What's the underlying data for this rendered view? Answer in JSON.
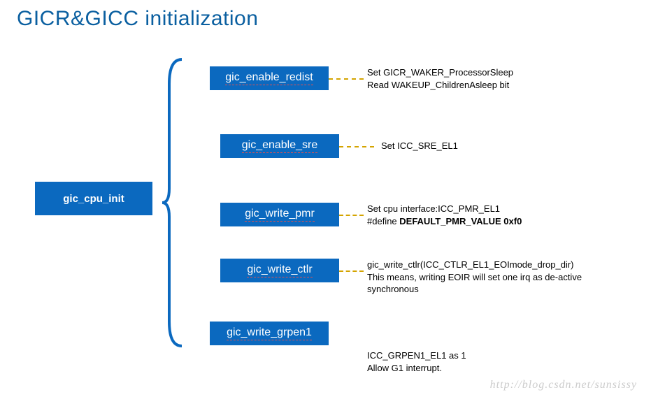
{
  "title": "GICR&GICC initialization",
  "root": "gic_cpu_init",
  "children": [
    {
      "label": "gic_enable_redist",
      "desc_lines": [
        "Set GICR_WAKER_ProcessorSleep",
        "Read WAKEUP_ChildrenAsleep bit"
      ]
    },
    {
      "label": "gic_enable_sre",
      "desc_lines": [
        "Set ICC_SRE_EL1"
      ]
    },
    {
      "label": "gic_write_pmr",
      "desc_lines": [
        "Set cpu interface:ICC_PMR_EL1",
        "#define DEFAULT_PMR_VALUE       0xf0"
      ]
    },
    {
      "label": "gic_write_ctlr",
      "desc_lines": [
        "gic_write_ctlr(ICC_CTLR_EL1_EOImode_drop_dir)",
        "This means, writing EOIR will set one irq as de-active",
        "synchronous"
      ]
    },
    {
      "label": "gic_write_grpen1",
      "desc_lines": [
        "ICC_GRPEN1_EL1    as 1",
        "Allow G1 interrupt."
      ]
    }
  ],
  "watermark": "http://blog.csdn.net/sunsissy",
  "colors": {
    "accent": "#0b69bf",
    "title": "#0a5fa0",
    "dashline": "#d4a400"
  }
}
